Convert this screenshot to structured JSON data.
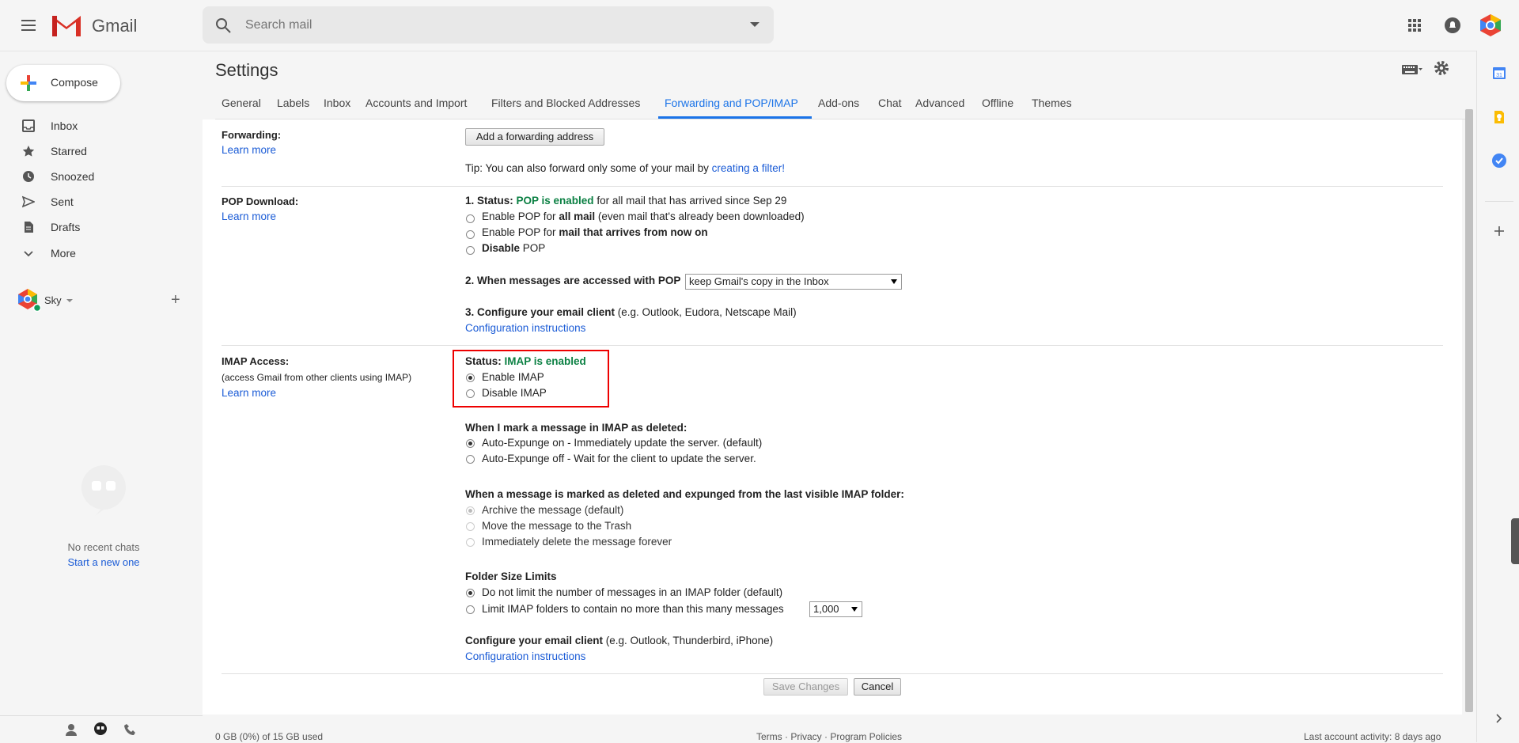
{
  "app": {
    "name": "Gmail",
    "search_placeholder": "Search mail"
  },
  "compose_label": "Compose",
  "nav": [
    {
      "label": "Inbox",
      "icon": "inbox-icon"
    },
    {
      "label": "Starred",
      "icon": "star-icon"
    },
    {
      "label": "Snoozed",
      "icon": "clock-icon"
    },
    {
      "label": "Sent",
      "icon": "send-icon"
    },
    {
      "label": "Drafts",
      "icon": "draft-icon"
    },
    {
      "label": "More",
      "icon": "chevron-down-icon"
    }
  ],
  "hangouts": {
    "user": "Sky",
    "no_chats": "No recent chats",
    "start_new": "Start a new one"
  },
  "page_title": "Settings",
  "tabs": [
    "General",
    "Labels",
    "Inbox",
    "Accounts and Import",
    "Filters and Blocked Addresses",
    "Forwarding and POP/IMAP",
    "Add-ons",
    "Chat",
    "Advanced",
    "Offline",
    "Themes"
  ],
  "active_tab": "Forwarding and POP/IMAP",
  "forwarding": {
    "label": "Forwarding:",
    "learn_more": "Learn more",
    "add_button": "Add a forwarding address",
    "tip_prefix": "Tip: You can also forward only some of your mail by ",
    "tip_link": "creating a filter!"
  },
  "pop": {
    "label": "POP Download:",
    "learn_more": "Learn more",
    "status_label": "1. Status: ",
    "status_value": "POP is enabled",
    "status_suffix": " for all mail that has arrived since Sep 29",
    "options": [
      {
        "pre": "Enable POP for ",
        "bold": "all mail",
        "post": " (even mail that's already been downloaded)",
        "selected": false
      },
      {
        "pre": "Enable POP for ",
        "bold": "mail that arrives from now on",
        "post": "",
        "selected": false
      },
      {
        "pre": "",
        "bold": "Disable",
        "post": " POP",
        "selected": false
      }
    ],
    "when_accessed_label": "2. When messages are accessed with POP",
    "when_accessed_value": "keep Gmail's copy in the Inbox",
    "configure_label": "3. Configure your email client",
    "configure_hint": " (e.g. Outlook, Eudora, Netscape Mail)",
    "config_link": "Configuration instructions"
  },
  "imap": {
    "label": "IMAP Access:",
    "sub": "(access Gmail from other clients using IMAP)",
    "learn_more": "Learn more",
    "status_label": "Status: ",
    "status_value": "IMAP is enabled",
    "enable": "Enable IMAP",
    "disable": "Disable IMAP",
    "enabled": true,
    "deleted_heading": "When I mark a message in IMAP as deleted:",
    "deleted_options": [
      {
        "label": "Auto-Expunge on - Immediately update the server. (default)",
        "selected": true
      },
      {
        "label": "Auto-Expunge off - Wait for the client to update the server.",
        "selected": false
      }
    ],
    "expunged_heading": "When a message is marked as deleted and expunged from the last visible IMAP folder:",
    "expunged_options": [
      {
        "label": "Archive the message (default)",
        "selected": true
      },
      {
        "label": "Move the message to the Trash",
        "selected": false
      },
      {
        "label": "Immediately delete the message forever",
        "selected": false
      }
    ],
    "folder_heading": "Folder Size Limits",
    "folder_options": [
      {
        "label": "Do not limit the number of messages in an IMAP folder (default)",
        "selected": true
      },
      {
        "label": "Limit IMAP folders to contain no more than this many messages",
        "selected": false
      }
    ],
    "folder_limit_value": "1,000",
    "configure_label": "Configure your email client",
    "configure_hint": " (e.g. Outlook, Thunderbird, iPhone)",
    "config_link": "Configuration instructions"
  },
  "buttons": {
    "save": "Save Changes",
    "cancel": "Cancel"
  },
  "footer": {
    "storage": "0 GB (0%) of 15 GB used",
    "links": "Terms · Privacy · Program Policies",
    "activity": "Last account activity: 8 days ago"
  },
  "colors": {
    "accent": "#1a73e8",
    "status_green": "#0b8043",
    "highlight": "#e00000"
  }
}
